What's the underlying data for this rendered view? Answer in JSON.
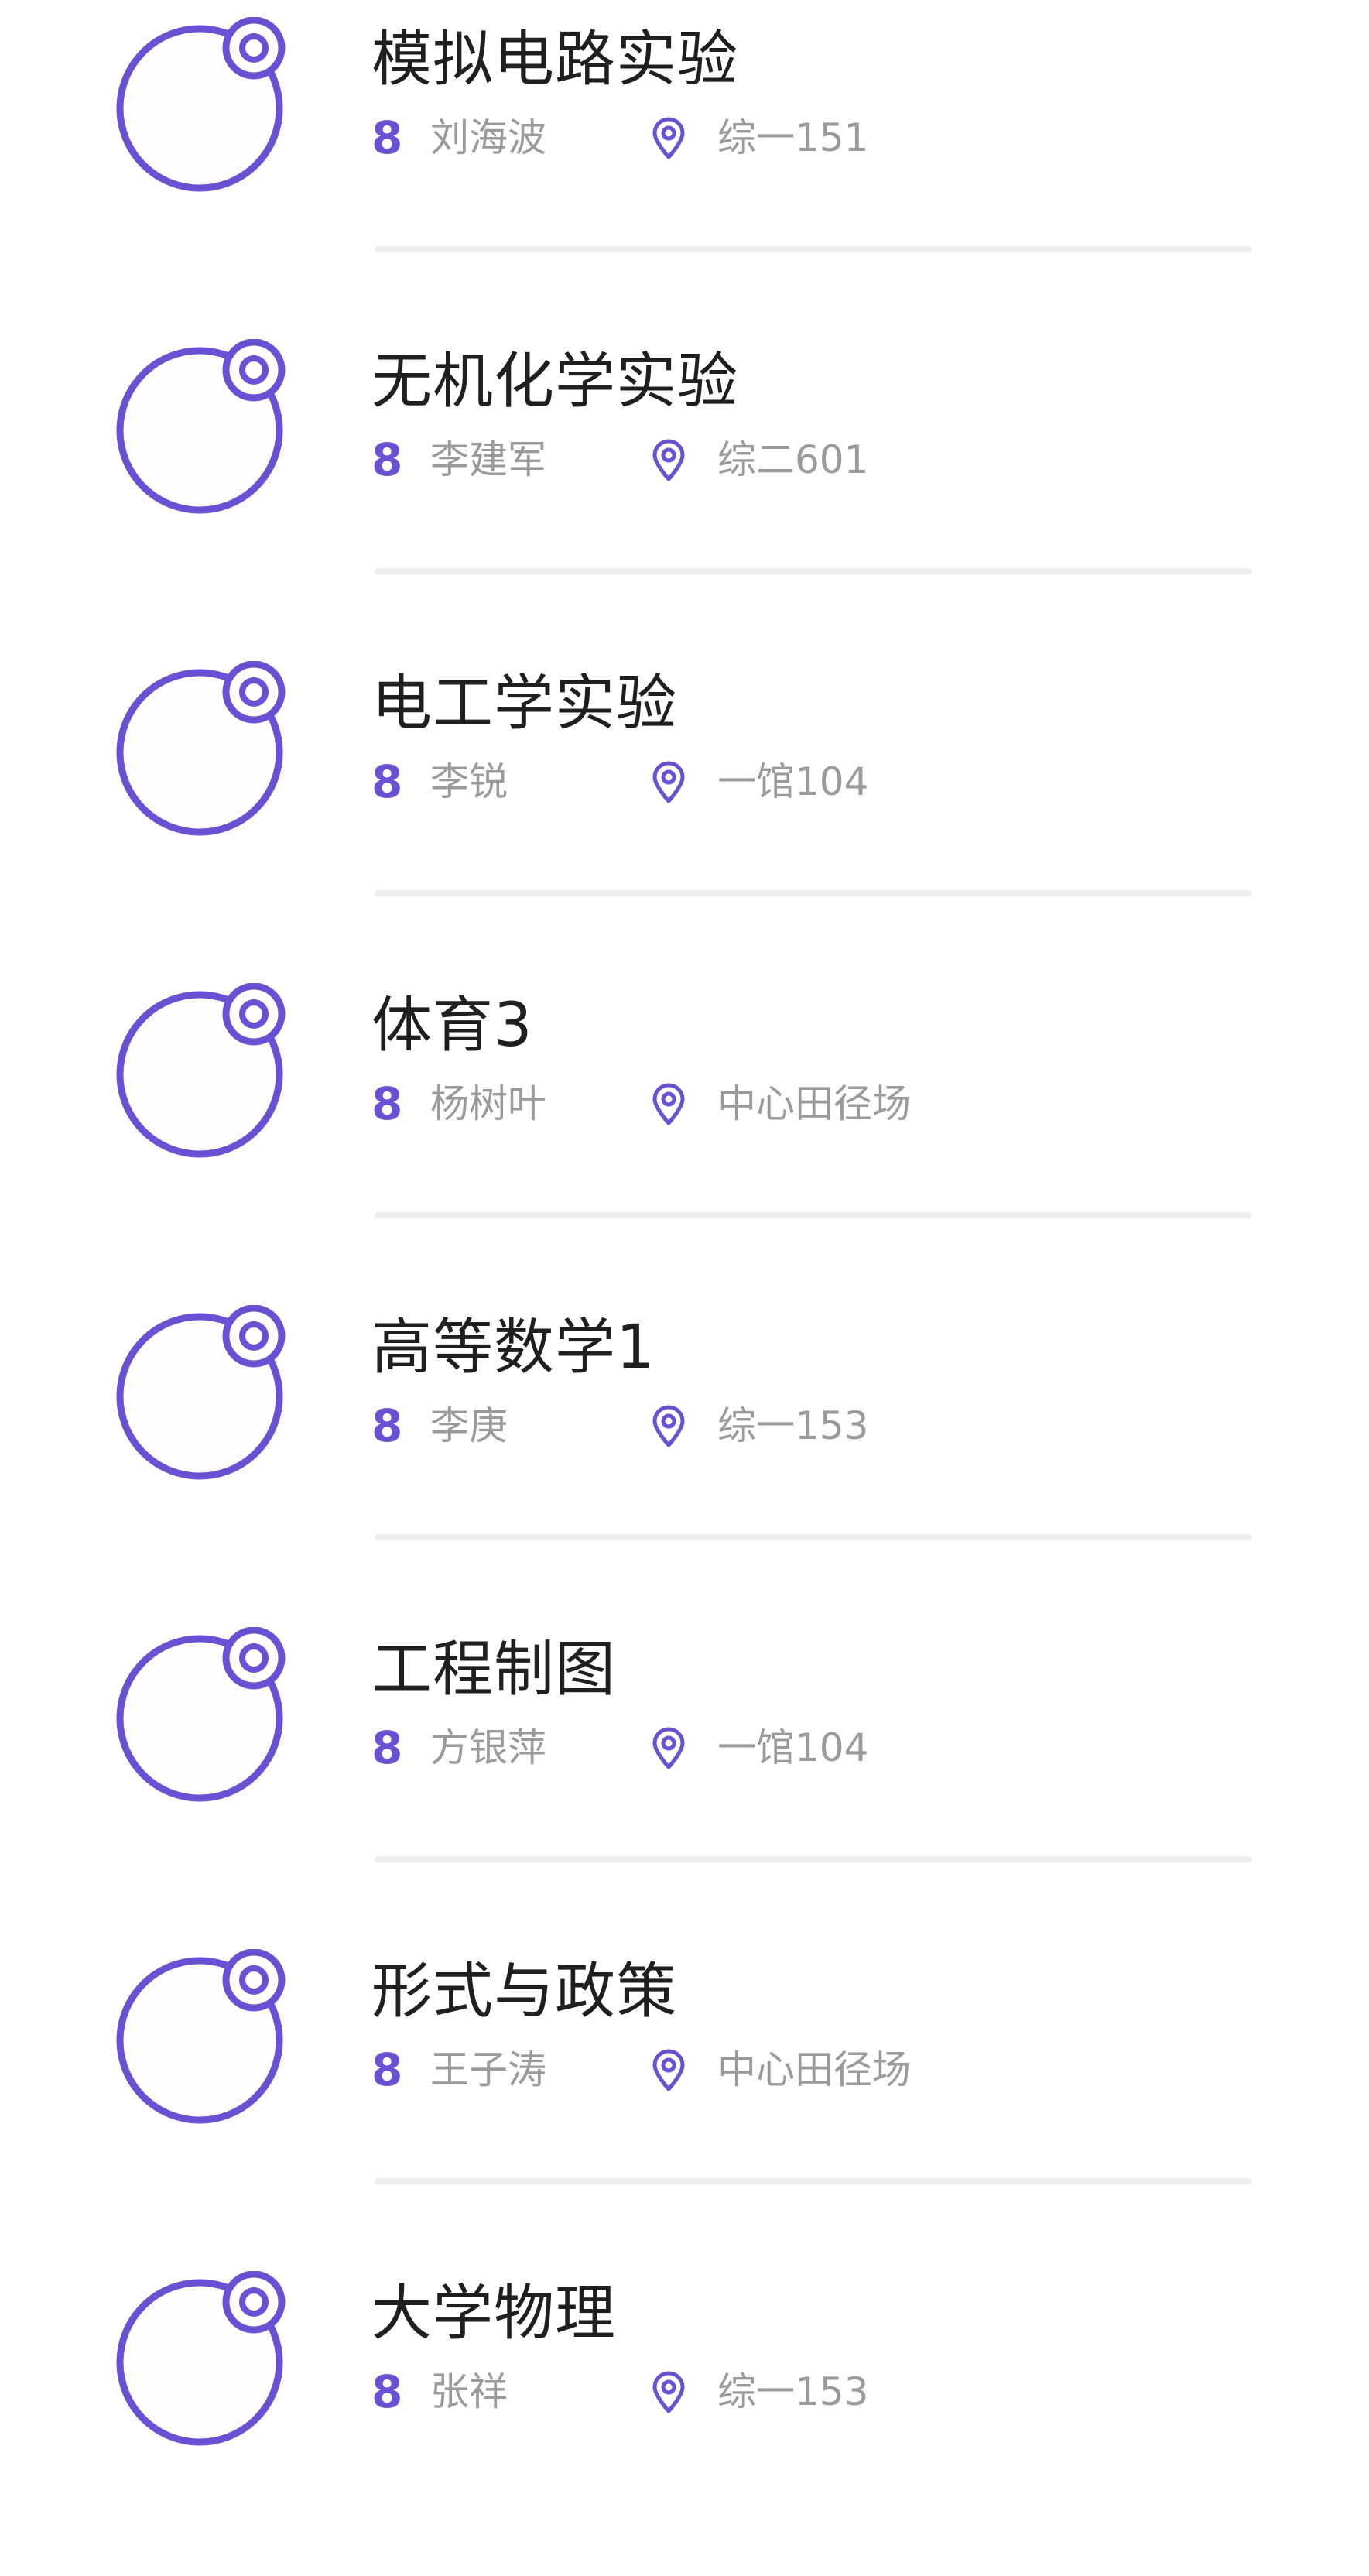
{
  "accent_color": "#6a50d3",
  "icons": {
    "course": "course-circle-icon",
    "teacher": "person-icon",
    "location": "location-pin-icon"
  },
  "teacher_glyph": "8",
  "courses": [
    {
      "title": "模拟电路实验",
      "teacher": "刘海波",
      "location": "综一151"
    },
    {
      "title": "无机化学实验",
      "teacher": "李建军",
      "location": "综二601"
    },
    {
      "title": "电工学实验",
      "teacher": "李锐",
      "location": "一馆104"
    },
    {
      "title": "体育3",
      "teacher": "杨树叶",
      "location": "中心田径场"
    },
    {
      "title": "高等数学1",
      "teacher": "李庚",
      "location": "综一153"
    },
    {
      "title": "工程制图",
      "teacher": "方银萍",
      "location": "一馆104"
    },
    {
      "title": "形式与政策",
      "teacher": "王子涛",
      "location": "中心田径场"
    },
    {
      "title": "大学物理",
      "teacher": "张祥",
      "location": "综一153"
    }
  ]
}
